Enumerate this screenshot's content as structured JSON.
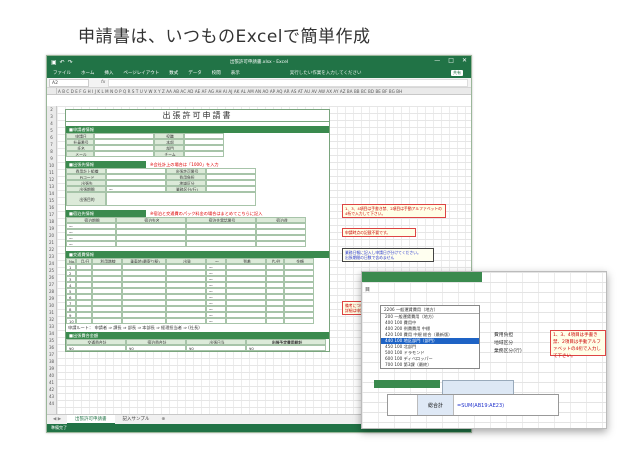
{
  "heading": "申請書は、いつものExcelで簡単作成",
  "window": {
    "title": "出張許可申請書.xlsx - Excel",
    "qa_icons": [
      "save-icon",
      "undo-icon",
      "redo-icon"
    ],
    "controls": [
      "—",
      "□",
      "✕"
    ]
  },
  "ribbon": {
    "tabs": [
      "ファイル",
      "ホーム",
      "挿入",
      "ページレイアウト",
      "数式",
      "データ",
      "校閲",
      "表示"
    ],
    "tellme": "実行したい作業を入力してください",
    "user": "共有"
  },
  "formula_bar": {
    "name_box": "A2",
    "fx": "fx"
  },
  "columns": "A B C D E F G H I J K L M N O P Q R S T U V W X Y Z AA AB AC AD AE AF AG AH AI AJ AK AL AM AN AO AP AQ AR AS AT AU AV AW AX AY AZ BA BB BC BD BE BF BG BH",
  "rows": [
    "2",
    "3",
    "4",
    "5",
    "6",
    "7",
    "8",
    "9",
    "10",
    "11",
    "12",
    "13",
    "14",
    "15",
    "16",
    "17",
    "18",
    "19",
    "20",
    "21",
    "22",
    "23",
    "24",
    "25",
    "26",
    "27",
    "28",
    "29",
    "30",
    "31",
    "32",
    "33",
    "34",
    "35",
    "36",
    "37",
    "38",
    "39",
    "40",
    "41",
    "42",
    "43",
    "44"
  ],
  "form": {
    "title": "出張許可申請書",
    "sec1": "■申請者情報",
    "sec1_rows": [
      [
        "申請日",
        "",
        "役職",
        ""
      ],
      [
        "社員番号",
        "",
        "本部",
        ""
      ],
      [
        "氏名",
        "",
        "部門",
        ""
      ],
      [
        "メール",
        "",
        "チーム",
        ""
      ]
    ],
    "sec2": "■出張先情報",
    "sec2_note": "※会社計上の場合は「1000」を入力",
    "sec2_rows": [
      [
        "費用計上組織",
        "",
        "出張許可番号",
        ""
      ],
      [
        "PJコード",
        "",
        "費用負担",
        ""
      ],
      [
        "出張先",
        "",
        "地域区分",
        ""
      ],
      [
        "出張期間",
        "～",
        "業務区分(行)",
        ""
      ]
    ],
    "sec2_purpose": "出張目的",
    "sec3": "■宿泊先情報",
    "sec3_note": "※宿泊と交通費のパック料金の場合はまとめてこちらに記入",
    "sec3_headers": [
      "宿泊期間",
      "宿泊先名",
      "宿泊先電話番号",
      "宿泊費"
    ],
    "sec4": "■交通費情報",
    "sec4_headers": [
      "No.",
      "月/日",
      "利用路線",
      "乗車地(最寄り駅)",
      "出発",
      "～",
      "到着",
      "片/往",
      "金額"
    ],
    "sec4_route": "申請ルート： 申請者 ⇒ 課長 ⇒ 部長 ⇒ 本部長 ⇒ 経理担当者 ⇒ (社長)",
    "sec5": "■出張費合金額",
    "sec5_headers": [
      "交通費合計",
      "宿泊費合計",
      "出張日当",
      "出張予定費用総計"
    ],
    "sec5_values": [
      "¥0",
      "¥0",
      "¥0",
      "¥0"
    ]
  },
  "notes": [
    "1、3、4項目は手書き禁、2項目は手動アルファベットの4桁で入力して下さい。",
    "申請時点の記載不要です。",
    "業務日報に記入し申請日が分けてください。\n出張期間の日数で含めません",
    "備考について重量品がいります。\n詳細は申請書番号を参照の注記記入"
  ],
  "sheet_tabs": [
    "出張許可申請書",
    "記入サンプル"
  ],
  "status": {
    "left": "準備完了",
    "zoom": "100%"
  },
  "zoom": {
    "label_top": "目",
    "dropdown_selected": "2206 一般運賃費用（地方）",
    "dropdown_options": [
      "200 一般運賃費用（地方）",
      "400 100 費用中",
      "400 200 例費費用 中標",
      "420 100 費用 中規 総合（最新版）",
      "440 100 地区部門（部門）",
      "450 100 北部門",
      "500 100 ドラモンド",
      "600 100 ディベロッパー",
      "700 100 第3課（最終）"
    ],
    "note": "1、3、4項目は手書き禁、2項目は手動アルファベットの4桁で入力して下さい。",
    "cells": [
      "費用負担",
      "地域区分",
      "業務区分(行)"
    ],
    "sum_label": "総合計",
    "sum_formula": "=SUM(AB19:AE23)"
  }
}
